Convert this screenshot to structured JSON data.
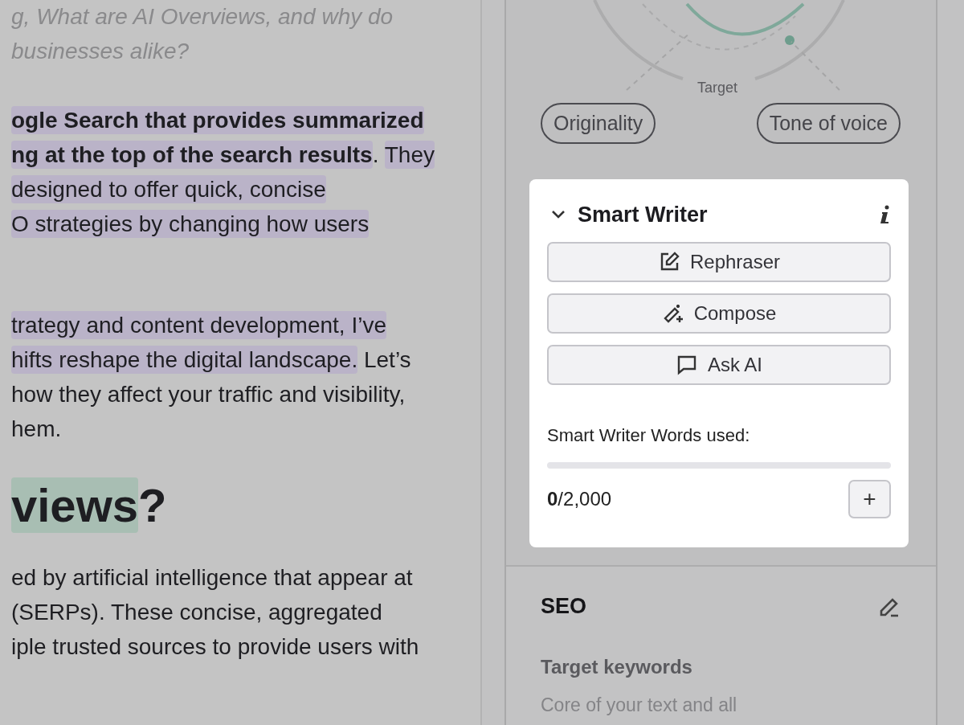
{
  "editor": {
    "blocks": [
      {
        "kind": "intro",
        "lines": [
          [
            {
              "text": "g, What are AI Overviews, and why do",
              "highlighted": false,
              "bold": false
            }
          ],
          [
            {
              "text": "businesses alike?",
              "highlighted": false,
              "bold": false
            }
          ]
        ]
      },
      {
        "kind": "para",
        "lines": [
          [
            {
              "text": "ogle Search that provides summarized",
              "highlighted": true,
              "bold": true
            }
          ],
          [
            {
              "text": "ng at the top of the search results",
              "highlighted": true,
              "bold": true
            },
            {
              "text": ". ",
              "highlighted": false,
              "bold": false
            },
            {
              "text": "They",
              "highlighted": true,
              "bold": false
            }
          ],
          [
            {
              "text": "designed to offer quick, concise",
              "highlighted": true,
              "bold": false
            }
          ],
          [
            {
              "text": "O strategies by changing how users",
              "highlighted": true,
              "bold": false
            }
          ]
        ]
      },
      {
        "kind": "para",
        "lines": [
          [
            {
              "text": "trategy and content development, I’ve",
              "highlighted": true,
              "bold": false
            }
          ],
          [
            {
              "text": "hifts reshape the digital landscape.",
              "highlighted": true,
              "bold": false
            },
            {
              "text": " Let’s",
              "highlighted": false,
              "bold": false
            }
          ],
          [
            {
              "text": "how they affect your traffic and visibility,",
              "highlighted": false,
              "bold": false
            }
          ],
          [
            {
              "text": "hem.",
              "highlighted": false,
              "bold": false
            }
          ]
        ]
      },
      {
        "kind": "heading",
        "lines": [
          [
            {
              "text": "views",
              "highlighted": true,
              "bold": true
            },
            {
              "text": "?",
              "highlighted": false,
              "bold": true
            }
          ]
        ]
      },
      {
        "kind": "para",
        "lines": [
          [
            {
              "text": "ed by artificial intelligence that appear at",
              "highlighted": false,
              "bold": false
            }
          ],
          [
            {
              "text": "(SERPs). These concise, aggregated",
              "highlighted": false,
              "bold": false
            }
          ],
          [
            {
              "text": "iple trusted sources to provide users with",
              "highlighted": false,
              "bold": false
            }
          ]
        ]
      }
    ]
  },
  "sidebar": {
    "gauge": {
      "label": "Target"
    },
    "pills": [
      "Originality",
      "Tone of voice"
    ],
    "smart_writer": {
      "title": "Smart Writer",
      "expanded": true,
      "actions": [
        {
          "label": "Rephraser",
          "kind": "rephraser"
        },
        {
          "label": "Compose",
          "kind": "compose"
        },
        {
          "label": "Ask AI",
          "kind": "ask"
        }
      ],
      "usage_label": "Smart Writer Words used:",
      "level": 0,
      "usage": "**0**/2,000",
      "add_button": "+"
    },
    "seo": {
      "title": "SEO",
      "subtitle": "Target keywords",
      "hint": "Core of your text and all"
    }
  }
}
